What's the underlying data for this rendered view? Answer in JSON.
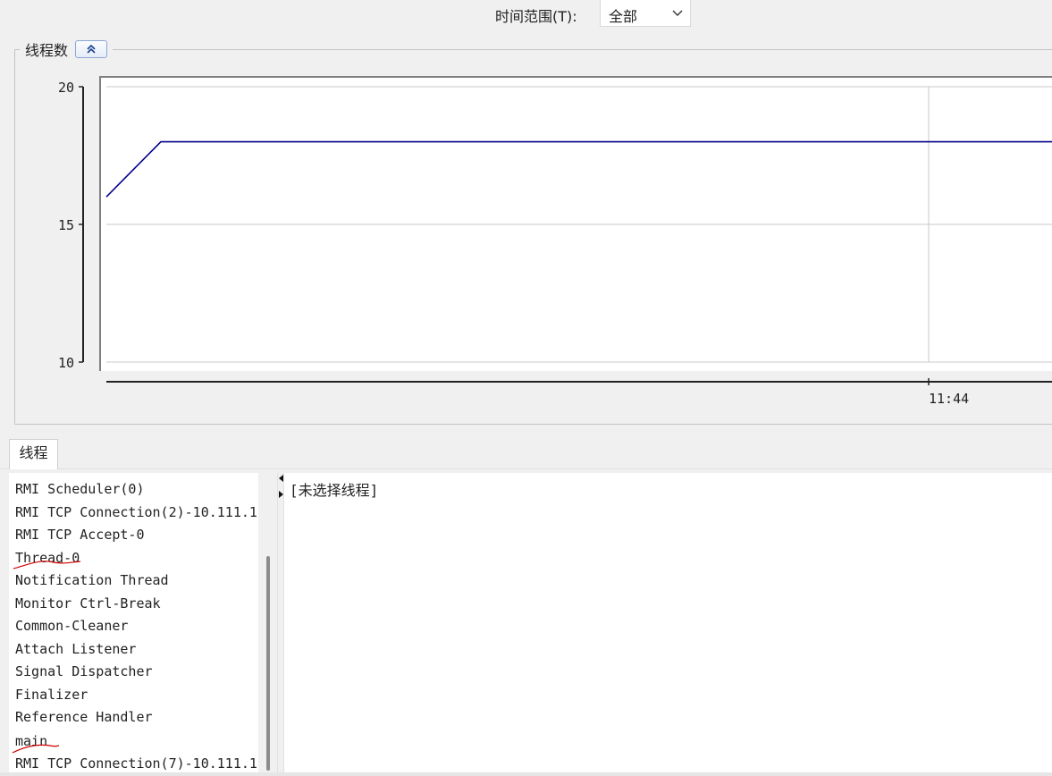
{
  "time_range": {
    "label": "时间范围(T):",
    "selected": "全部"
  },
  "panel": {
    "title": "线程数"
  },
  "chart_data": {
    "type": "line",
    "title": "",
    "xlabel": "",
    "ylabel": "",
    "ylim": [
      10,
      20
    ],
    "yticks": [
      10,
      15,
      20
    ],
    "xtick_labels": [
      "11:44"
    ],
    "grid": true,
    "series": [
      {
        "color": "#00008b",
        "points": [
          [
            0,
            16
          ],
          [
            1,
            18
          ],
          [
            2,
            18
          ],
          [
            3,
            18
          ],
          [
            4,
            18
          ]
        ]
      }
    ]
  },
  "tabs": [
    {
      "label": "线程"
    }
  ],
  "thread_list": {
    "items": [
      "RMI Scheduler(0)",
      "RMI TCP Connection(2)-10.111.1",
      "RMI TCP Accept-0",
      "Thread-0",
      "Notification Thread",
      "Monitor Ctrl-Break",
      "Common-Cleaner",
      "Attach Listener",
      "Signal Dispatcher",
      "Finalizer",
      "Reference Handler",
      "main",
      "RMI TCP Connection(7)-10.111.1"
    ]
  },
  "detail": {
    "text": "[未选择线程]"
  },
  "colors": {
    "line": "#00008b",
    "annotation": "#d00000",
    "grid": "#c8c8c8"
  }
}
